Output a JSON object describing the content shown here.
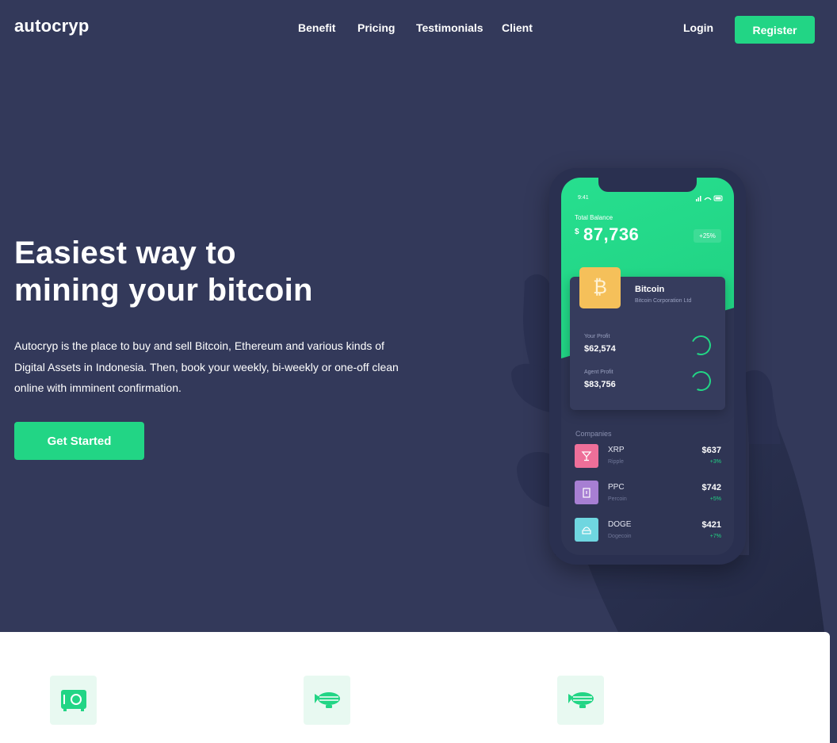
{
  "brand": {
    "logo": "autocryp",
    "accent": "#22d585",
    "background": "#33395a"
  },
  "nav": {
    "links": [
      "Benefit",
      "Pricing",
      "Testimonials",
      "Client"
    ],
    "login": "Login",
    "register": "Register"
  },
  "hero": {
    "title_line1": "Easiest way to",
    "title_line2": "mining your bitcoin",
    "description": "Autocryp is the place to buy and sell Bitcoin, Ethereum and various kinds of Digital Assets in Indonesia. Then, book your weekly, bi-weekly or one-off clean online with imminent confirmation.",
    "cta": "Get Started"
  },
  "phone": {
    "time": "9:41",
    "total_label": "Total Balance",
    "currency": "$",
    "total_value": "87,736",
    "total_change": "+25%",
    "coin": {
      "symbol": "₿",
      "name": "Bitcoin",
      "subtitle": "Bitcoin Corporation Ltd"
    },
    "profits": [
      {
        "label": "Your Profit",
        "value": "$62,574"
      },
      {
        "label": "Agent Profit",
        "value": "$83,756"
      }
    ],
    "companies_title": "Companies",
    "companies": [
      {
        "icon": "cocktail-icon",
        "color": "#ee6f99",
        "name": "XRP",
        "sub": "Ripple",
        "price": "$637",
        "change": "+3%"
      },
      {
        "icon": "building-icon",
        "color": "#a77fd3",
        "name": "PPC",
        "sub": "Percoin",
        "price": "$742",
        "change": "+5%"
      },
      {
        "icon": "coin-stack-icon",
        "color": "#6fd6e0",
        "name": "DOGE",
        "sub": "Dogecoin",
        "price": "$421",
        "change": "+7%"
      }
    ]
  },
  "features": [
    {
      "icon": "safe-icon"
    },
    {
      "icon": "zeppelin-icon"
    },
    {
      "icon": "zeppelin-icon"
    }
  ]
}
